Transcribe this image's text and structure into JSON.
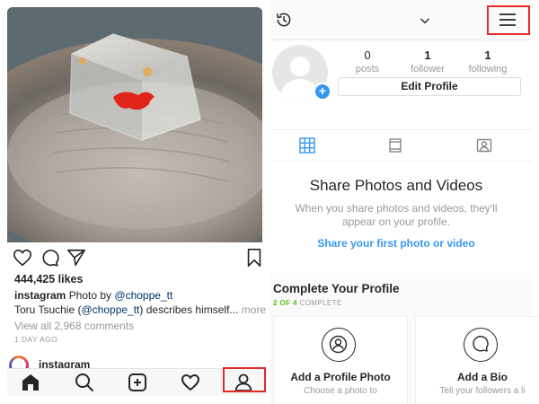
{
  "feed": {
    "likes": "444,425 likes",
    "caption": {
      "username": "instagram",
      "text": " Photo by ",
      "mention": "@choppe_tt"
    },
    "caption_line2": {
      "prefix": "Toru Tsuchie (",
      "mention": "@choppe_tt",
      "suffix": ") describes himself...",
      "more": " more"
    },
    "view_comments": "View all 2,968 comments",
    "time_ago": "1 DAY AGO",
    "next_post_username": "instagram",
    "icons": {
      "like": "heart-outline-icon",
      "comment": "comment-bubble-icon",
      "share": "paper-plane-icon",
      "save": "bookmark-icon"
    },
    "tab_icons": [
      "home-icon",
      "search-icon",
      "add-post-icon",
      "activity-heart-icon",
      "profile-icon"
    ]
  },
  "profile": {
    "stats": [
      {
        "count": "0",
        "label": "posts"
      },
      {
        "count": "1",
        "label": "follower"
      },
      {
        "count": "1",
        "label": "following"
      }
    ],
    "edit_profile_label": "Edit Profile",
    "empty_state": {
      "title": "Share Photos and Videos",
      "description": "When you share photos and videos, they'll appear on your profile.",
      "action": "Share your first photo or video"
    },
    "complete": {
      "title": "Complete Your Profile",
      "progress_done": "2 OF 4",
      "progress_rest": " COMPLETE",
      "cards": [
        {
          "title": "Add a Profile Photo",
          "description": "Choose a photo to",
          "icon": "avatar-circle-icon"
        },
        {
          "title": "Add a Bio",
          "description": "Tell your followers a li",
          "icon": "speech-bubble-icon"
        }
      ]
    }
  },
  "colors": {
    "highlight": "#e32b2b",
    "link": "#3897f0",
    "progress": "#58c322"
  }
}
